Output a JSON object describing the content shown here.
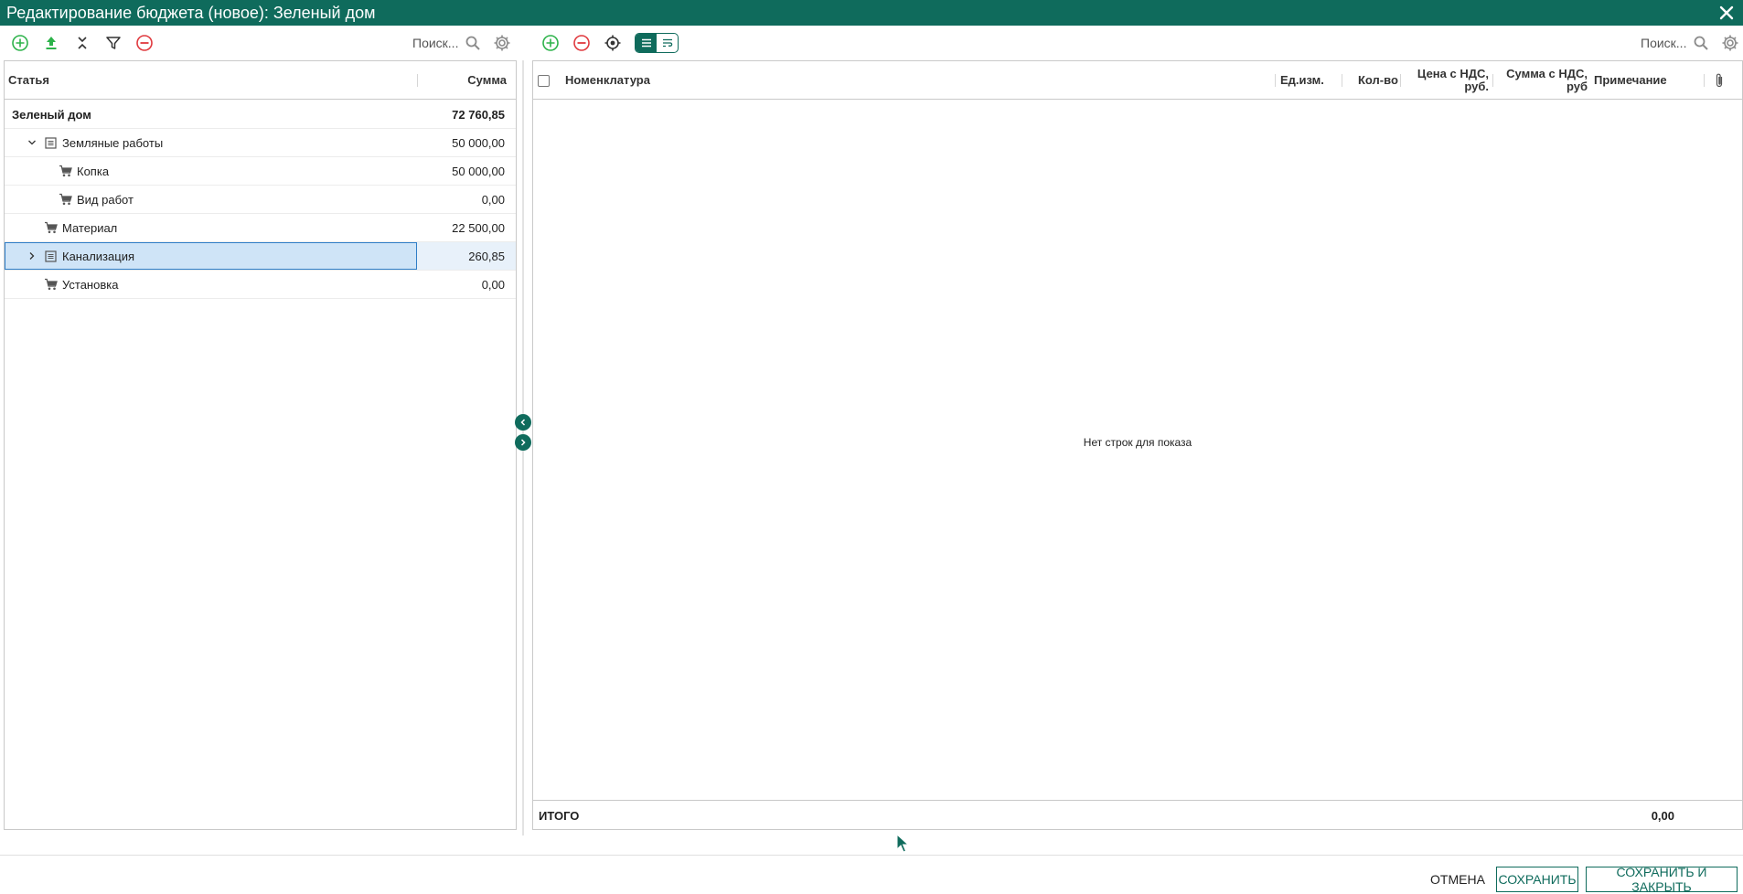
{
  "window": {
    "title": "Редактирование бюджета (новое): Зеленый дом"
  },
  "left_toolbar": {
    "search_placeholder": "Поиск..."
  },
  "right_toolbar": {
    "search_placeholder": "Поиск..."
  },
  "tree": {
    "headers": {
      "article": "Статья",
      "sum": "Сумма"
    },
    "rows": [
      {
        "name": "Зеленый дом",
        "sum": "72 760,85"
      },
      {
        "name": "Земляные работы",
        "sum": "50 000,00"
      },
      {
        "name": "Копка",
        "sum": "50 000,00"
      },
      {
        "name": "Вид работ",
        "sum": "0,00"
      },
      {
        "name": "Материал",
        "sum": "22 500,00"
      },
      {
        "name": "Канализация",
        "sum": "260,85"
      },
      {
        "name": "Установка",
        "sum": "0,00"
      }
    ]
  },
  "items": {
    "headers": {
      "nomenclature": "Номенклатура",
      "unit": "Ед.изм.",
      "qty": "Кол-во",
      "price_line1": "Цена с НДС,",
      "price_line2": "руб.",
      "sum_line1": "Сумма с НДС,",
      "sum_line2": "руб",
      "note": "Примечание"
    },
    "empty_text": "Нет строк для показа",
    "total_label": "ИТОГО",
    "total_value": "0,00"
  },
  "footer": {
    "cancel": "ОТМЕНА",
    "save": "СОХРАНИТЬ",
    "save_close": "СОХРАНИТЬ И ЗАКРЫТЬ"
  },
  "colors": {
    "brand": "#0f6b5c",
    "add": "#2db34a",
    "remove": "#e0393e",
    "selection": "#cfe4f7"
  }
}
